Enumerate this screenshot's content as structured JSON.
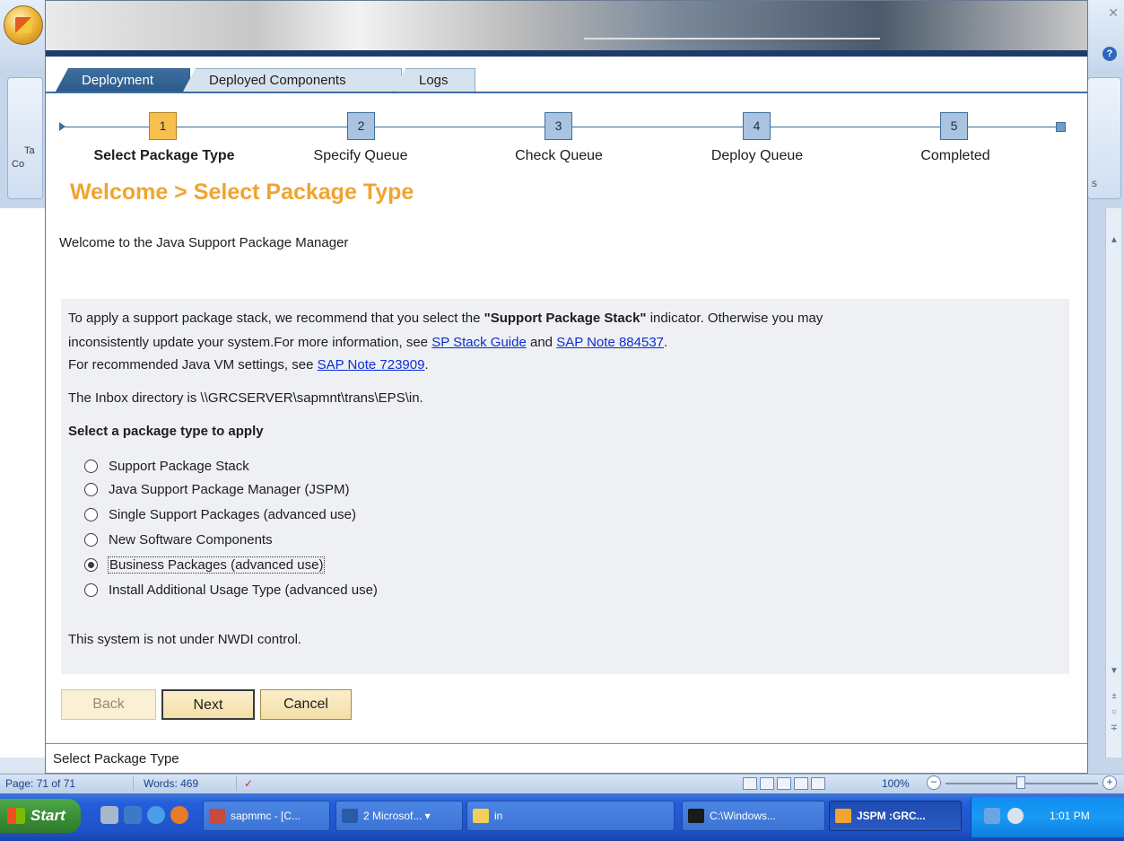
{
  "word": {
    "ribbon_left_label_1": "Ta",
    "ribbon_left_label_2": "Co",
    "ribbon_right_label": "s",
    "status": {
      "page": "Page: 71 of 71",
      "words": "Words: 469",
      "zoom": "100%"
    }
  },
  "jspm": {
    "tabs": [
      {
        "label": "Deployment",
        "active": true
      },
      {
        "label": "Deployed Components",
        "active": false
      },
      {
        "label": "Logs",
        "active": false
      }
    ],
    "roadmap": [
      {
        "num": "1",
        "label": "Select Package Type",
        "active": true
      },
      {
        "num": "2",
        "label": "Specify Queue",
        "active": false
      },
      {
        "num": "3",
        "label": "Check Queue",
        "active": false
      },
      {
        "num": "4",
        "label": "Deploy Queue",
        "active": false
      },
      {
        "num": "5",
        "label": "Completed",
        "active": false
      }
    ],
    "heading": "Welcome > Select Package Type",
    "welcome_text": "Welcome to the Java Support Package Manager",
    "info": {
      "line1_a": "To apply a support package stack, we recommend that you select the ",
      "line1_bold": "\"Support Package Stack\"",
      "line1_b": " indicator. Otherwise you may",
      "line2_a": "inconsistently update your system.For more information, see ",
      "link_sp_stack": "SP Stack Guide",
      "line2_and": " and ",
      "link_note_884537": "SAP Note 884537",
      "line2_end": ".",
      "line3_a": "For recommended Java VM settings, see ",
      "link_note_723909": "SAP Note 723909",
      "line3_end": ".",
      "inbox": "The Inbox directory is \\\\GRCSERVER\\sapmnt\\trans\\EPS\\in."
    },
    "select_title": "Select a package type to apply",
    "options": [
      {
        "label": "Support Package Stack",
        "checked": false
      },
      {
        "label": "Java Support Package Manager (JSPM)",
        "checked": false
      },
      {
        "label": "Single Support Packages (advanced use)",
        "checked": false
      },
      {
        "label": "New Software Components",
        "checked": false
      },
      {
        "label": "Business Packages (advanced use)",
        "checked": true
      },
      {
        "label": "Install Additional Usage Type (advanced use)",
        "checked": false
      }
    ],
    "nwdi_text": "This system is not under NWDI control.",
    "buttons": {
      "back": "Back",
      "next": "Next",
      "cancel": "Cancel"
    },
    "statusbar": "Select Package Type"
  },
  "taskbar": {
    "start": "Start",
    "tasks": [
      {
        "label": "sapmmc - [C...",
        "active": false
      },
      {
        "label": "2 Microsof... ▾",
        "active": false
      },
      {
        "label": "in",
        "active": false
      },
      {
        "label": "C:\\Windows...",
        "active": false
      },
      {
        "label": "JSPM :GRC...",
        "active": true
      }
    ],
    "clock": "1:01 PM"
  },
  "colors": {
    "accent_orange": "#f0a431",
    "tab_active": "#2c5b8a",
    "link": "#0c2ed6",
    "taskbar": "#245edb"
  }
}
